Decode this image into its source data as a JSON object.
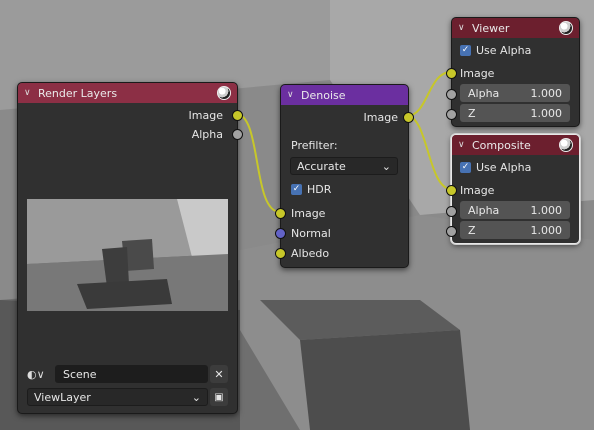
{
  "nodes": {
    "render_layers": {
      "title": "Render Layers",
      "outputs": [
        "Image",
        "Alpha"
      ],
      "scene": "Scene",
      "view_layer": "ViewLayer"
    },
    "denoise": {
      "title": "Denoise",
      "output": "Image",
      "prefilter_label": "Prefilter:",
      "prefilter_value": "Accurate",
      "hdr_label": "HDR",
      "hdr_checked": true,
      "inputs": [
        "Image",
        "Normal",
        "Albedo"
      ]
    },
    "viewer": {
      "title": "Viewer",
      "use_alpha_label": "Use Alpha",
      "use_alpha_checked": true,
      "image_label": "Image",
      "alpha_label": "Alpha",
      "alpha_value": "1.000",
      "z_label": "Z",
      "z_value": "1.000"
    },
    "composite": {
      "title": "Composite",
      "use_alpha_label": "Use Alpha",
      "use_alpha_checked": true,
      "image_label": "Image",
      "alpha_label": "Alpha",
      "alpha_value": "1.000",
      "z_label": "Z",
      "z_value": "1.000"
    }
  },
  "colors": {
    "input_header": "#8c2f45",
    "output_header": "#6c1f2e",
    "filter_header": "#6b2fa0",
    "image_socket": "#c7c729",
    "value_socket": "#a1a1a1",
    "vector_socket": "#6363c7",
    "link": "#c7c729"
  }
}
